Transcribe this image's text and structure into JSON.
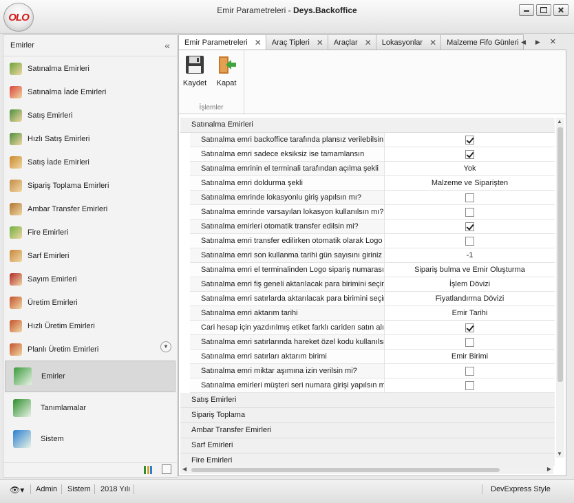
{
  "window": {
    "title_prefix": "Emir Parametreleri - ",
    "title_app": "Deys.Backoffice",
    "logo": "OLO"
  },
  "sidebar": {
    "header": "Emirler",
    "collapse_icon": "«",
    "items": [
      {
        "label": "Satınalma Emirleri",
        "icon": "cart-icon",
        "color": "#6aa33b"
      },
      {
        "label": "Satınalma İade Emirleri",
        "icon": "cart-return-icon",
        "color": "#d9453b"
      },
      {
        "label": "Satış Emirleri",
        "icon": "truck-icon",
        "color": "#4c8f3a"
      },
      {
        "label": "Hızlı Satış Emirleri",
        "icon": "fast-truck-icon",
        "color": "#4c8f3a"
      },
      {
        "label": "Satış İade Emirleri",
        "icon": "return-box-icon",
        "color": "#c98a2c"
      },
      {
        "label": "Sipariş Toplama Emirleri",
        "icon": "package-icon",
        "color": "#c58c45"
      },
      {
        "label": "Ambar Transfer Emirleri",
        "icon": "transfer-icon",
        "color": "#b07530"
      },
      {
        "label": "Fire Emirleri",
        "icon": "trash-icon",
        "color": "#6fb03f"
      },
      {
        "label": "Sarf Emirleri",
        "icon": "consume-icon",
        "color": "#c7873a"
      },
      {
        "label": "Sayım Emirleri",
        "icon": "book-icon",
        "color": "#b02828"
      },
      {
        "label": "Üretim Emirleri",
        "icon": "factory-icon",
        "color": "#c4522c"
      },
      {
        "label": "Hızlı Üretim Emirleri",
        "icon": "fast-factory-icon",
        "color": "#c4522c"
      },
      {
        "label": "Planlı Üretim Emirleri",
        "icon": "planned-factory-icon",
        "color": "#c4522c"
      }
    ],
    "groups": [
      {
        "label": "Emirler",
        "icon": "clipboard-icon",
        "color": "#3b9b3b",
        "active": true
      },
      {
        "label": "Tanımlamalar",
        "icon": "abc-board-icon",
        "color": "#2f8f2f",
        "active": false
      },
      {
        "label": "Sistem",
        "icon": "monitor-icon",
        "color": "#2c7fd0",
        "active": false
      }
    ]
  },
  "tabs": [
    {
      "label": "Emir Parametreleri",
      "active": true
    },
    {
      "label": "Araç Tipleri",
      "active": false
    },
    {
      "label": "Araçlar",
      "active": false
    },
    {
      "label": "Lokasyonlar",
      "active": false
    },
    {
      "label": "Malzeme Fifo Günleri",
      "active": false
    }
  ],
  "tab_close": "✕",
  "ribbon": {
    "save_label": "Kaydet",
    "close_label": "Kapat",
    "group_label": "İşlemler"
  },
  "grid": {
    "category": "Satınalma Emirleri",
    "rows": [
      {
        "name": "Satınalma emri backoffice tarafında plansız verilebilsin mi?",
        "type": "check",
        "value": true
      },
      {
        "name": "Satınalma emri sadece eksiksiz ise tamamlansın",
        "type": "check",
        "value": true
      },
      {
        "name": "Satınalma emrinin el terminali tarafından açılma şekli",
        "type": "text",
        "value": "Yok"
      },
      {
        "name": "Satınalma emri doldurma şekli",
        "type": "text",
        "value": "Malzeme ve Siparişten"
      },
      {
        "name": "Satınalma emrinde lokasyonlu giriş yapılsın mı?",
        "type": "check",
        "value": false
      },
      {
        "name": "Satınalma emrinde varsayılan lokasyon kullanılsın mı?",
        "type": "check",
        "value": false
      },
      {
        "name": "Satınalma emirleri otomatik transfer edilsin mi?",
        "type": "check",
        "value": true
      },
      {
        "name": "Satınalma emri transfer edilirken otomatik olarak Logo",
        "type": "check",
        "value": false
      },
      {
        "name": "Satınalma emri son kullanma tarihi gün sayısını giriniz",
        "type": "text",
        "value": "-1"
      },
      {
        "name": "Satınalma emri el terminalinden Logo sipariş numarası",
        "type": "text",
        "value": "Sipariş bulma ve Emir Oluşturma"
      },
      {
        "name": "Satınalma emri fiş geneli aktarılacak para birimini seçiniz",
        "type": "text",
        "value": "İşlem Dövizi"
      },
      {
        "name": "Satınalma emri satırlarda aktarılacak para birimini seçiniz",
        "type": "text",
        "value": "Fiyatlandırma Dövizi"
      },
      {
        "name": "Satınalma emri aktarım tarihi",
        "type": "text",
        "value": "Emir Tarihi"
      },
      {
        "name": "Cari hesap için yazdırılmış etiket farklı cariden satın alınsın",
        "type": "check",
        "value": true
      },
      {
        "name": "Satınalma emri satırlarında hareket özel kodu kullanılsın",
        "type": "check",
        "value": false
      },
      {
        "name": "Satınalma emri satırları aktarım birimi",
        "type": "text",
        "value": "Emir Birimi"
      },
      {
        "name": "Satınalma emri miktar aşımına izin verilsin mi?",
        "type": "check",
        "value": false
      },
      {
        "name": "Satınalma emirleri müşteri seri numara girişi yapılsın mı?",
        "type": "check",
        "value": false
      }
    ],
    "other_categories": [
      "Satış Emirleri",
      "Sipariş Toplama",
      "Ambar Transfer Emirleri",
      "Sarf Emirleri",
      "Fire Emirleri"
    ]
  },
  "status": {
    "user": "Admin",
    "module": "Sistem",
    "year": "2018 Yılı",
    "style": "DevExpress Style"
  }
}
